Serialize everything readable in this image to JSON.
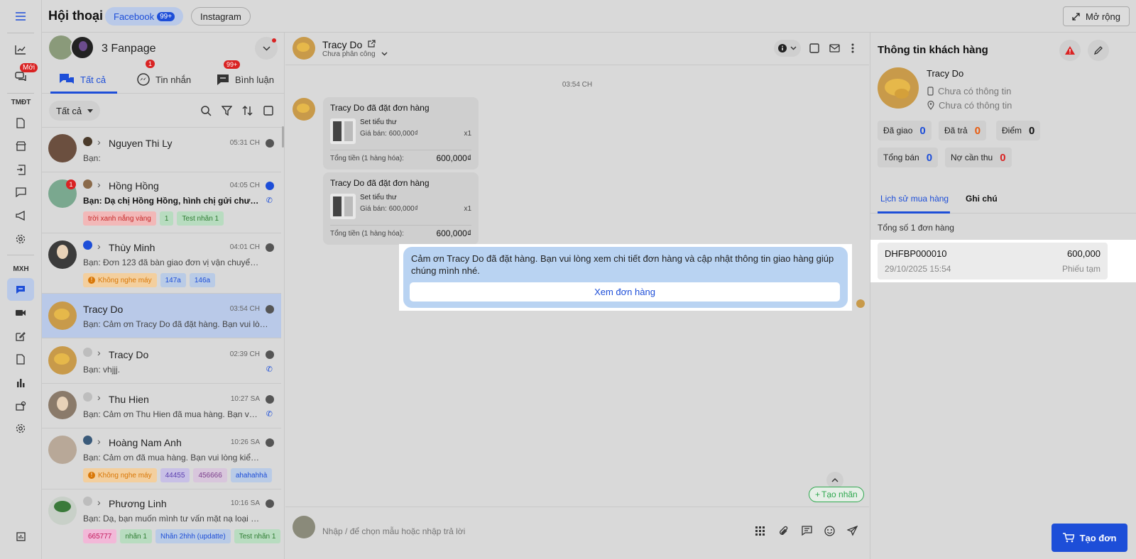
{
  "app": {
    "title": "Hội thoại",
    "channels": [
      {
        "label": "Facebook",
        "count": "99+"
      },
      {
        "label": "Instagram"
      }
    ],
    "expand_label": "Mở rộng"
  },
  "rail": {
    "new_badge": "Mới",
    "section_ecommerce": "TMĐT",
    "section_social": "MXH"
  },
  "list": {
    "fanpage_label": "3 Fanpage",
    "tabs": [
      {
        "label": "Tất cả"
      },
      {
        "label": "Tin nhắn",
        "badge": "1"
      },
      {
        "label": "Bình luận",
        "badge": "99+"
      }
    ],
    "filter_label": "Tất cả",
    "conversations": [
      {
        "name": "Nguyen Thi Ly",
        "time": "05:31 CH",
        "message": "Bạn:",
        "tags": []
      },
      {
        "name": "Hồng Hồng",
        "time": "04:05 CH",
        "message": "Bạn: Dạ chị Hồng Hồng, hình chị gửi chưa phù hợp",
        "unread": "1",
        "tags": [
          {
            "text": "trời xanh nắng vàng",
            "bg": "#f2b8b8",
            "fg": "#c62828"
          },
          {
            "text": "1",
            "bg": "#b8dcc0",
            "fg": "#2e7d32"
          },
          {
            "text": "Test nhãn 1",
            "bg": "#b8dcc0",
            "fg": "#2e7d32"
          }
        ]
      },
      {
        "name": "Thùy Minh",
        "time": "04:01 CH",
        "message": "Bạn: Đơn 123 đã bàn giao đơn vị vận chuyển Lincoln",
        "tags": [
          {
            "text": "Không nghe máy",
            "bg": "#f3cf9e",
            "fg": "#d97706",
            "icon": "!"
          },
          {
            "text": "147a",
            "bg": "#b9cbe6",
            "fg": "#1d4ed8"
          },
          {
            "text": "146a",
            "bg": "#b9cbe6",
            "fg": "#1d4ed8"
          }
        ]
      },
      {
        "name": "Tracy Do",
        "time": "03:54 CH",
        "message": "Bạn: Cảm ơn Tracy Do đã đặt hàng. Bạn vui lòng xem chi tiết",
        "selected": true,
        "tags": []
      },
      {
        "name": "Tracy Do",
        "time": "02:39 CH",
        "message": "Bạn: vhjjj.",
        "tags": []
      },
      {
        "name": "Thu Hien",
        "time": "10:27 SA",
        "message": "Bạn: Cảm ơn Thu Hien đã mua hàng. Bạn vui lòng kiểm tra",
        "tags": []
      },
      {
        "name": "Hoàng Nam Anh",
        "time": "10:26 SA",
        "message": "Bạn: Cảm ơn đã mua hàng. Bạn vui lòng kiểm tra lại",
        "tags": [
          {
            "text": "Không nghe máy",
            "bg": "#f3cf9e",
            "fg": "#d97706",
            "icon": "!"
          },
          {
            "text": "44455",
            "bg": "#c8c0e6",
            "fg": "#5b3fb0"
          },
          {
            "text": "456666",
            "bg": "#d8c6dc",
            "fg": "#7b3f8c"
          },
          {
            "text": "ahahahhà",
            "bg": "#b9cbe6",
            "fg": "#1d4ed8"
          }
        ]
      },
      {
        "name": "Phương Linh",
        "time": "10:16 SA",
        "message": "Bạn: Dạ, bạn muốn mình tư vấn mặt nạ loại nào ạ",
        "tags": [
          {
            "text": "665777",
            "bg": "#f2b8d8",
            "fg": "#c2185b"
          },
          {
            "text": "nhãn 1",
            "bg": "#b8dcc0",
            "fg": "#2e7d32"
          },
          {
            "text": "Nhãn 2hhh (updatte)",
            "bg": "#b9cbe6",
            "fg": "#1d4ed8"
          },
          {
            "text": "Test nhãn 1",
            "bg": "#b8dcc0",
            "fg": "#2e7d32"
          }
        ]
      }
    ]
  },
  "chat": {
    "name": "Tracy Do",
    "assign_status": "Chưa phân công",
    "timestamp": "03:54 CH",
    "orders": [
      {
        "title": "Tracy Do đã đặt đơn hàng",
        "product": "Set tiểu thư",
        "price": "Giá bán: 600,000₫",
        "qty": "x1",
        "total_label": "Tổng tiền (1 hàng hóa):",
        "total": "600,000₫"
      },
      {
        "title": "Tracy Do đã đặt đơn hàng",
        "product": "Set tiểu thư",
        "price": "Giá bán: 600,000₫",
        "qty": "x1",
        "total_label": "Tổng tiền (1 hàng hóa):",
        "total": "600,000₫"
      }
    ],
    "reply_text": "Cảm ơn Tracy Do đã đặt hàng. Bạn vui lòng xem chi tiết đơn hàng và cập nhật thông tin giao hàng giúp chúng mình nhé.",
    "reply_button": "Xem đơn hàng",
    "create_label": "Tạo nhãn",
    "input_placeholder": "Nhập / để chọn mẫu hoặc nhập trả lời"
  },
  "customer": {
    "title": "Thông tin khách hàng",
    "name": "Tracy Do",
    "phone": "Chưa có thông tin",
    "address": "Chưa có thông tin",
    "stats": [
      {
        "label": "Đã giao",
        "value": "0",
        "color": "#1d4ed8"
      },
      {
        "label": "Đã trả",
        "value": "0",
        "color": "#e8590c"
      },
      {
        "label": "Điểm",
        "value": "0",
        "color": "#111111"
      },
      {
        "label": "Tổng bán",
        "value": "0",
        "color": "#1d4ed8"
      },
      {
        "label": "Nợ cần thu",
        "value": "0",
        "color": "#d92323"
      }
    ],
    "tabs": [
      {
        "label": "Lịch sử mua hàng"
      },
      {
        "label": "Ghi chú"
      }
    ],
    "total_orders": "Tổng số 1 đơn hàng",
    "order": {
      "code": "DHFBP000010",
      "date": "29/10/2025 15:54",
      "amount": "600,000",
      "status": "Phiếu tạm"
    },
    "create_order": "Tạo đơn"
  },
  "colors": {
    "accent": "#1d4ed8",
    "danger": "#d92323",
    "success": "#2fa84f"
  }
}
